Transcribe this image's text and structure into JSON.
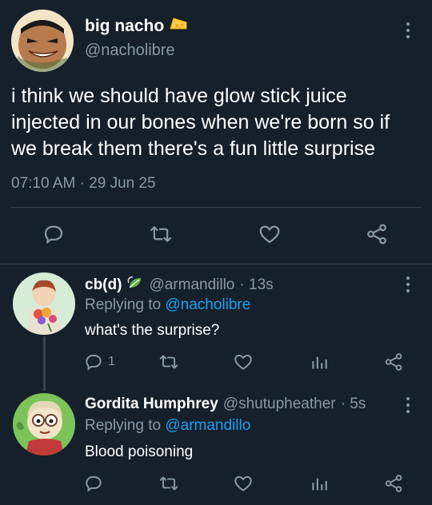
{
  "main_tweet": {
    "display_name": "big nacho",
    "handle": "@nacholibre",
    "text": "i think we should have glow stick juice injected in our bones when we're born so if we break them there's a fun little surprise",
    "timestamp": "07:10 AM · 29 Jun 25",
    "icons": [
      "cheese-emoji",
      "reply-icon",
      "retweet-icon",
      "like-icon",
      "share-icon",
      "more-icon"
    ]
  },
  "replies": [
    {
      "display_name": "cb(d)",
      "handle": "@armandillo",
      "time": "· 13s",
      "replying_prefix": "Replying to",
      "replying_handle": "@nacholibre",
      "text": "what's the surprise?",
      "reply_count": "1"
    },
    {
      "display_name": "Gordita Humphrey",
      "handle": "@shutupheather",
      "time": "· 5s",
      "replying_prefix": "Replying to",
      "replying_handle": "@armandillo",
      "text": "Blood poisoning",
      "reply_count": ""
    }
  ],
  "colors": {
    "background": "#15202b",
    "divider": "#38444d",
    "muted_text": "#8899a6",
    "link": "#1da1f2",
    "text": "#ffffff"
  }
}
